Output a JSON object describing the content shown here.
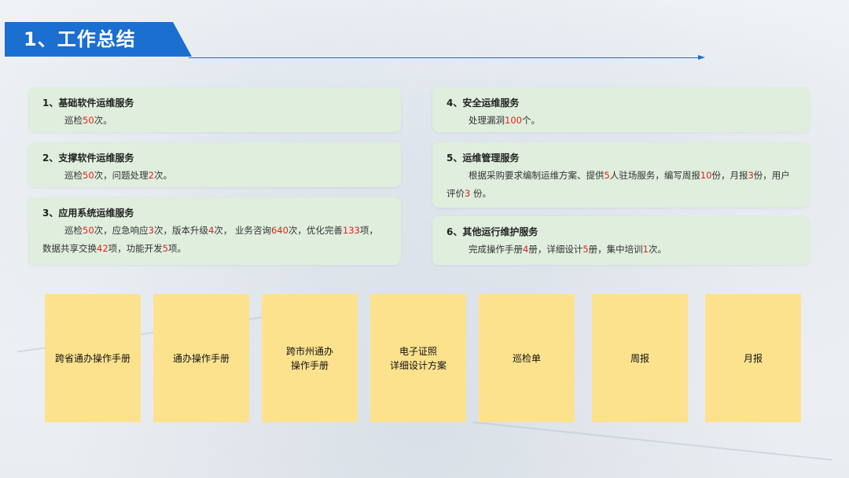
{
  "header": {
    "title": "1、工作总结"
  },
  "services": [
    {
      "title": "1、基础软件运维服务",
      "body": [
        {
          "t": "巡检",
          "n": false
        },
        {
          "t": "50",
          "n": true
        },
        {
          "t": "次。",
          "n": false
        }
      ]
    },
    {
      "title": "2、支撑软件运维服务",
      "body": [
        {
          "t": "巡检",
          "n": false
        },
        {
          "t": "50",
          "n": true
        },
        {
          "t": "次，问题处理",
          "n": false
        },
        {
          "t": "2",
          "n": true
        },
        {
          "t": "次。",
          "n": false
        }
      ]
    },
    {
      "title": "3、应用系统运维服务",
      "body": [
        {
          "t": "巡检",
          "n": false
        },
        {
          "t": "50",
          "n": true
        },
        {
          "t": "次，应急响应",
          "n": false
        },
        {
          "t": "3",
          "n": true
        },
        {
          "t": "次，版本升级",
          "n": false
        },
        {
          "t": "4",
          "n": true
        },
        {
          "t": "次， 业务咨询",
          "n": false
        },
        {
          "t": "640",
          "n": true
        },
        {
          "t": "次，优化完善",
          "n": false
        },
        {
          "t": "133",
          "n": true
        },
        {
          "t": "项，数据共享交换",
          "n": false
        },
        {
          "t": "42",
          "n": true
        },
        {
          "t": "项，功能开发",
          "n": false
        },
        {
          "t": "5",
          "n": true
        },
        {
          "t": "项。",
          "n": false
        }
      ]
    },
    {
      "title": "4、安全运维服务",
      "body": [
        {
          "t": "处理漏洞",
          "n": false
        },
        {
          "t": "100",
          "n": true
        },
        {
          "t": "个。",
          "n": false
        }
      ]
    },
    {
      "title": "5、运维管理服务",
      "body": [
        {
          "t": "根据采购要求编制运维方案、提供",
          "n": false
        },
        {
          "t": "5",
          "n": true
        },
        {
          "t": "人驻场服务，编写周报",
          "n": false
        },
        {
          "t": "10",
          "n": true
        },
        {
          "t": "份，月报",
          "n": false
        },
        {
          "t": "3",
          "n": true
        },
        {
          "t": "份，用户评价",
          "n": false
        },
        {
          "t": "3",
          "n": true
        },
        {
          "t": " 份。",
          "n": false
        }
      ]
    },
    {
      "title": "6、其他运行维护服务",
      "body": [
        {
          "t": "完成操作手册",
          "n": false
        },
        {
          "t": "4",
          "n": true
        },
        {
          "t": "册，详细设计",
          "n": false
        },
        {
          "t": "5",
          "n": true
        },
        {
          "t": "册，集中培训",
          "n": false
        },
        {
          "t": "1",
          "n": true
        },
        {
          "t": "次。",
          "n": false
        }
      ]
    }
  ],
  "documents": [
    {
      "lines": [
        "跨省通办操作手册"
      ]
    },
    {
      "lines": [
        "通办操作手册"
      ]
    },
    {
      "lines": [
        "跨市州通办",
        "操作手册"
      ]
    },
    {
      "lines": [
        "电子证照",
        "详细设计方案"
      ]
    },
    {
      "lines": [
        "巡检单"
      ]
    },
    {
      "lines": [
        "周报"
      ]
    },
    {
      "lines": [
        "月报"
      ]
    }
  ],
  "colors": {
    "header_blue": "#1a6fd1",
    "card_green": "#dfeedd",
    "doc_yellow": "#fde28e",
    "highlight_red": "#e3231c"
  }
}
